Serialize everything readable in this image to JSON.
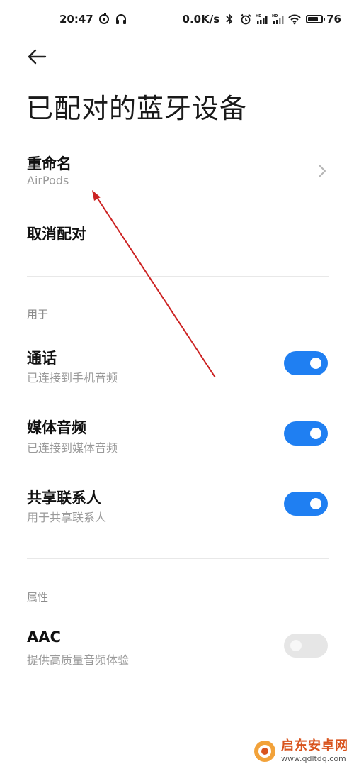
{
  "status_bar": {
    "time": "20:47",
    "network_speed": "0.0K/s",
    "battery_percent": "76",
    "battery_level": 0.76,
    "icons_left": [
      "sync-icon",
      "headset-icon"
    ],
    "icons_right": [
      "bluetooth-icon",
      "alarm-icon",
      "hd-signal-icon",
      "hd-signal-icon",
      "wifi-icon",
      "battery-icon"
    ]
  },
  "header": {
    "back_icon": "arrow-left-icon",
    "title": "已配对的蓝牙设备"
  },
  "rename": {
    "label": "重命名",
    "value": "AirPods",
    "chevron_icon": "chevron-right-icon"
  },
  "unpair": {
    "label": "取消配对"
  },
  "section_usage": {
    "label": "用于",
    "items": [
      {
        "title": "通话",
        "subtitle": "已连接到手机音频",
        "enabled": true
      },
      {
        "title": "媒体音频",
        "subtitle": "已连接到媒体音频",
        "enabled": true
      },
      {
        "title": "共享联系人",
        "subtitle": "用于共享联系人",
        "enabled": true
      }
    ]
  },
  "section_properties": {
    "label": "属性",
    "items": [
      {
        "title": "AAC",
        "subtitle": "提供高质量音频体验",
        "enabled": false
      }
    ]
  },
  "watermark": {
    "name": "启东安卓网",
    "url": "www.qdltdq.com"
  },
  "colors": {
    "toggle_on": "#1f7ff2",
    "toggle_off": "#e6e6e6",
    "annotation_arrow": "#cc2222",
    "watermark_accent": "#d9541e"
  }
}
